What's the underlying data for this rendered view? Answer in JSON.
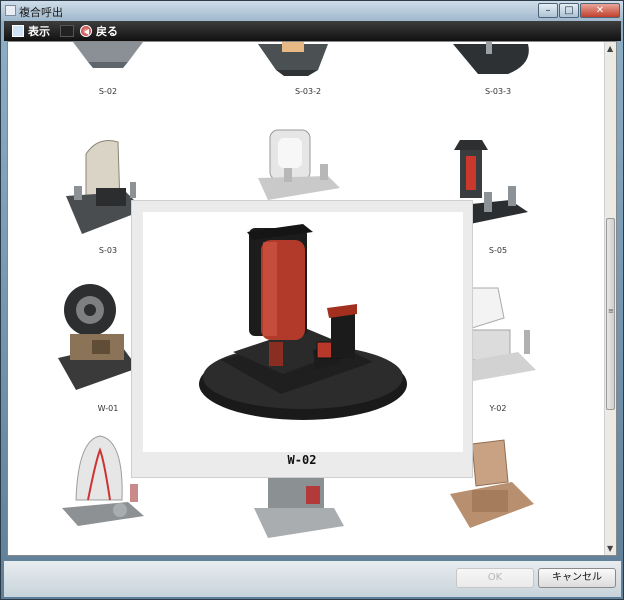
{
  "window": {
    "title": "複合呼出"
  },
  "toolbar": {
    "view_label": "表示",
    "back_label": "戻る"
  },
  "grid": {
    "items": [
      {
        "label": "S-02",
        "icon": "tombstone-gray"
      },
      {
        "label": "S-03-2",
        "icon": "tombstone-dark"
      },
      {
        "label": "S-03-3",
        "icon": "tombstone-black"
      },
      {
        "label": "S-03",
        "icon": "tombstone-granite"
      },
      {
        "label": "",
        "icon": "tombstone-white"
      },
      {
        "label": "S-05",
        "icon": "tombstone-red"
      },
      {
        "label": "W-01",
        "icon": "tombstone-wheel"
      },
      {
        "label": "",
        "icon": "hidden"
      },
      {
        "label": "Y-02",
        "icon": "tombstone-white-modern"
      },
      {
        "label": "",
        "icon": "tombstone-arch"
      },
      {
        "label": "",
        "icon": "tombstone-gray-red"
      },
      {
        "label": "",
        "icon": "tombstone-tan"
      }
    ]
  },
  "preview": {
    "name": "W-02"
  },
  "buttons": {
    "ok_label": "OK",
    "cancel_label": "キャンセル"
  }
}
